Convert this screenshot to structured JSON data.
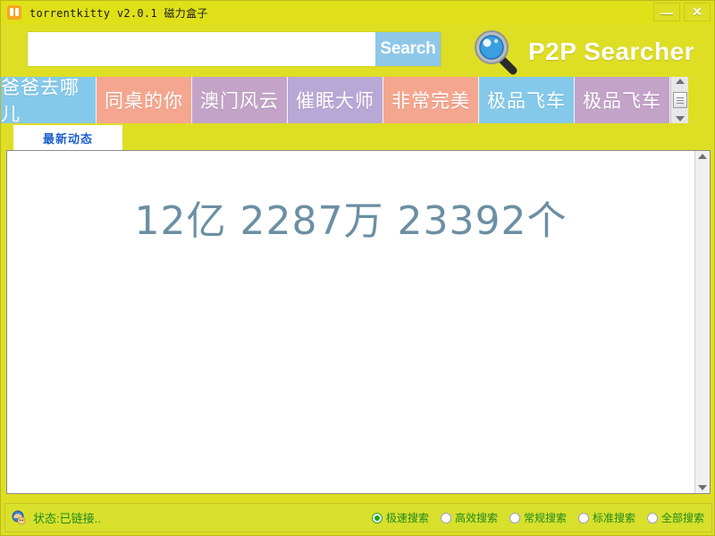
{
  "window": {
    "title": "torrentkitty  v2.0.1  磁力盒子",
    "icon": "cat-icon",
    "controls": [
      {
        "name": "minimize-button",
        "glyph": "—"
      },
      {
        "name": "close-button",
        "glyph": "✕"
      }
    ],
    "background_color": "#dede24",
    "titlebar_color": "#e0e019"
  },
  "search": {
    "value": "",
    "placeholder": "",
    "button_label": "Search",
    "button_color": "#8ec7e8"
  },
  "brand": {
    "icon": "magnifier-icon",
    "title": "P2P Searcher",
    "color": "#ffffff"
  },
  "tabs": [
    {
      "label": "爸爸去哪儿",
      "color": "#85c9ea"
    },
    {
      "label": "同桌的你",
      "color": "#f5a68e"
    },
    {
      "label": "澳门风云",
      "color": "#c3a3c8"
    },
    {
      "label": "催眠大师",
      "color": "#b8a8d6"
    },
    {
      "label": "非常完美",
      "color": "#f5a68e"
    },
    {
      "label": "极品飞车",
      "color": "#85c9ea"
    },
    {
      "label": "极品飞车",
      "color": "#c3a3c8"
    }
  ],
  "subtabs": [
    {
      "label": "最新动态",
      "active": true
    }
  ],
  "content": {
    "count_text": "12亿 2287万 23392个",
    "count_color": "#6b8fa3"
  },
  "statusbar": {
    "icon": "status-connected-icon",
    "text": "状态:已链接..",
    "text_color": "#1f8a1f",
    "background_color": "#d8e02c",
    "search_modes": [
      {
        "label": "极速搜索",
        "checked": true
      },
      {
        "label": "高效搜索",
        "checked": false
      },
      {
        "label": "常规搜索",
        "checked": false
      },
      {
        "label": "标准搜索",
        "checked": false
      },
      {
        "label": "全部搜索",
        "checked": false
      }
    ]
  }
}
